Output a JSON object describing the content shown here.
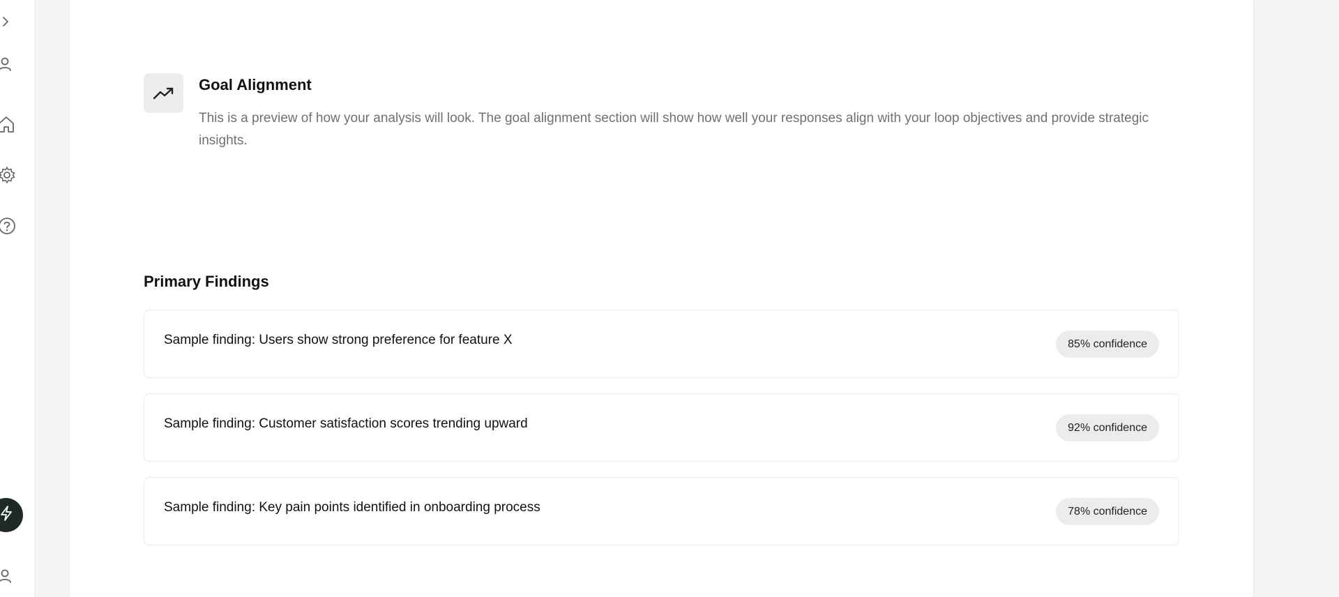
{
  "sidebar": {
    "icons": [
      "chevron-right-icon",
      "user-icon",
      "home-icon",
      "gear-icon",
      "help-icon",
      "lightning-icon",
      "user-icon"
    ],
    "accent_dark": "#1f2a24"
  },
  "goal": {
    "title": "Goal Alignment",
    "description": "This is a preview of how your analysis will look. The goal alignment section will show how well your responses align with your loop objectives and provide strategic insights.",
    "icon": "trending-up-icon"
  },
  "findings": {
    "title": "Primary Findings",
    "items": [
      {
        "text": "Sample finding: Users show strong preference for feature X",
        "confidence": "85% confidence"
      },
      {
        "text": "Sample finding: Customer satisfaction scores trending upward",
        "confidence": "92% confidence"
      },
      {
        "text": "Sample finding: Key pain points identified in onboarding process",
        "confidence": "78% confidence"
      }
    ]
  }
}
